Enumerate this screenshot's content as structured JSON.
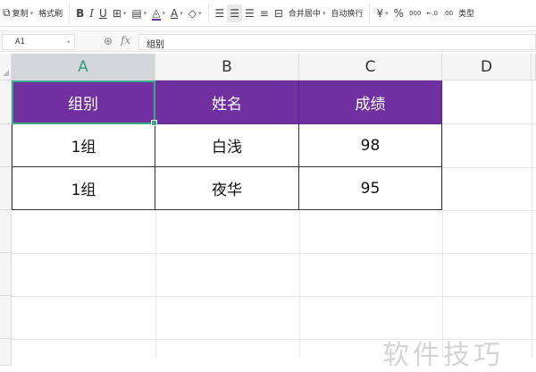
{
  "toolbar": {
    "copy": "复制",
    "format_painter": "格式刷",
    "bold": "B",
    "italic": "I",
    "underline": "U",
    "merge_center": "合并居中",
    "wrap_text": "自动换行",
    "currency": "¥",
    "percent": "%",
    "thousands": "000",
    "dec_inc": "←.0",
    "dec_dec": ".00",
    "type_convert": "类型"
  },
  "formula_bar": {
    "name_box": "A1",
    "zoom_icon": "⊕",
    "fx": "fx",
    "value": "组别"
  },
  "columns": [
    "A",
    "B",
    "C",
    "D"
  ],
  "table": {
    "headers": [
      "组别",
      "姓名",
      "成绩"
    ],
    "rows": [
      [
        "1组",
        "白浅",
        "98"
      ],
      [
        "1组",
        "夜华",
        "95"
      ]
    ]
  },
  "colors": {
    "header_bg": "#7030a0",
    "selection": "#3aaa8a"
  },
  "watermark": "软件技巧"
}
